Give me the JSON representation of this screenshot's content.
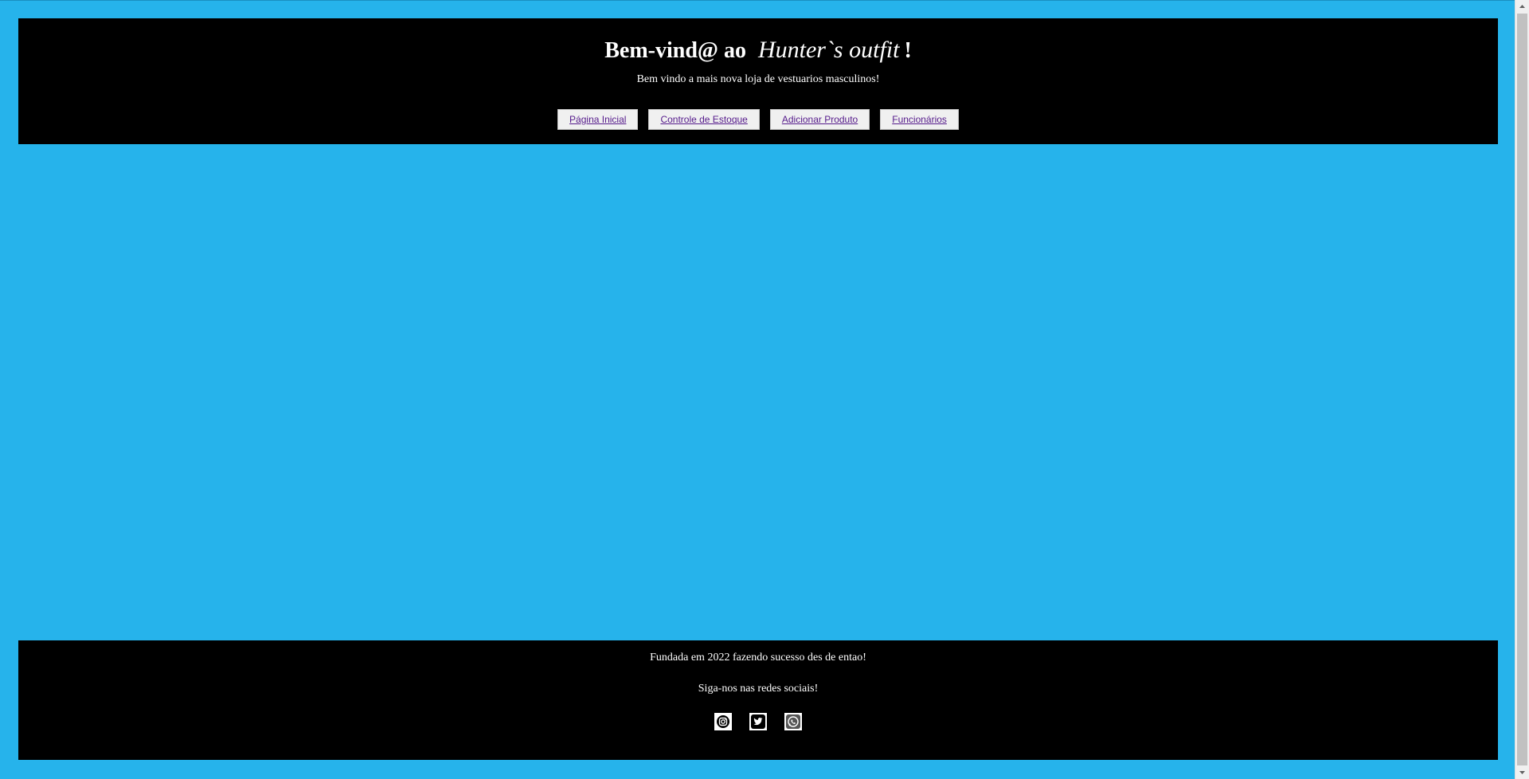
{
  "header": {
    "title_prefix": "Bem-vind@ ao",
    "title_brand": "Hunter`s outfit",
    "title_suffix": "!",
    "subtitle": "Bem vindo a mais nova loja de vestuarios masculinos!",
    "nav": [
      {
        "label": "Página Inicial"
      },
      {
        "label": "Controle de Estoque"
      },
      {
        "label": "Adicionar Produto"
      },
      {
        "label": "Funcionários"
      }
    ]
  },
  "footer": {
    "line1": "Fundada em 2022 fazendo sucesso des de entao!",
    "line2": "Siga-nos nas redes sociais!",
    "socials": [
      {
        "icon": "instagram-icon"
      },
      {
        "icon": "twitter-icon"
      },
      {
        "icon": "whatsapp-icon"
      }
    ]
  },
  "colors": {
    "page_background": "#26b3eb",
    "panel_background": "#000000",
    "link_color": "#551a8b"
  }
}
